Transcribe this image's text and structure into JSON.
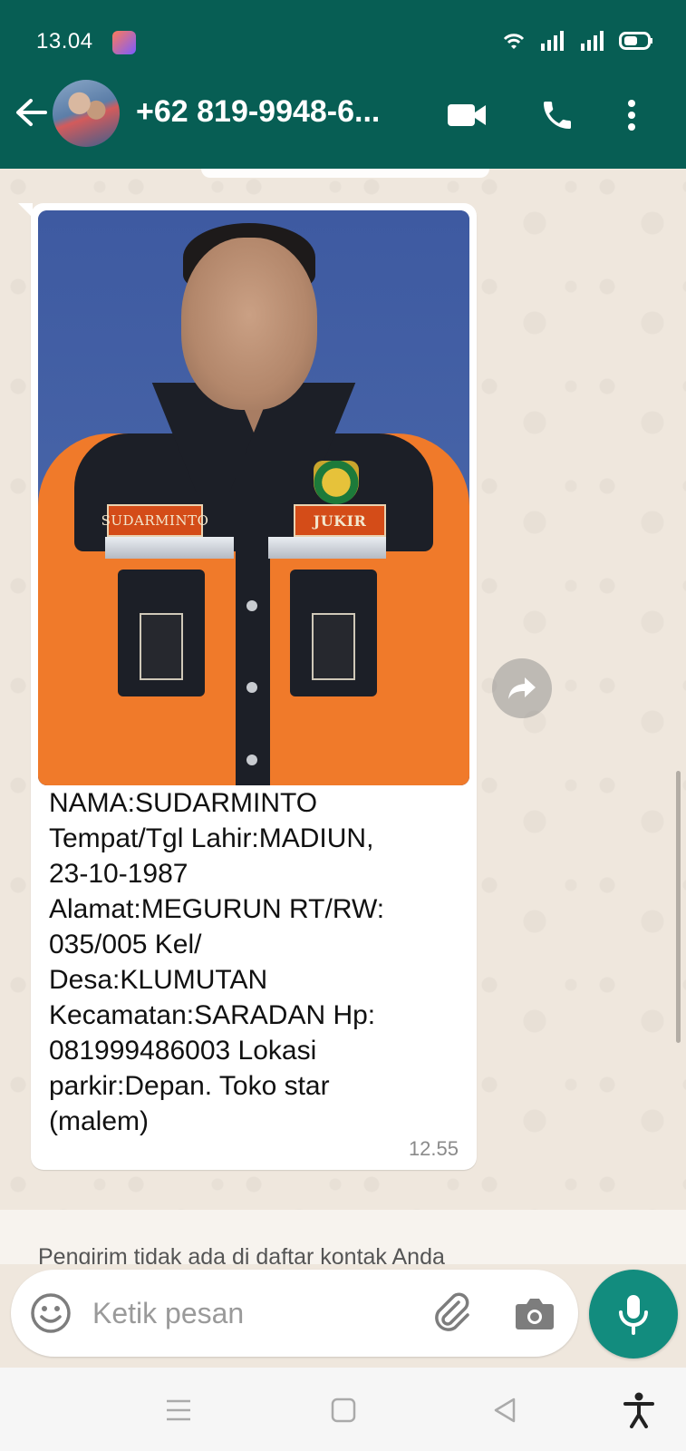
{
  "status_bar": {
    "time": "13.04"
  },
  "header": {
    "contact_name": "+62 819-9948-6..."
  },
  "message": {
    "caption": "NAMA:SUDARMINTO\nTempat/Tgl Lahir:MADIUN,\n23-10-1987\nAlamat:MEGURUN RT/RW:\n035/005 Kel/\nDesa:KLUMUTAN\nKecamatan:SARADAN Hp:\n081999486003 Lokasi\nparkir:Depan. Toko star\n(malem)",
    "time": "12.55",
    "photo_labels": {
      "name_tag": "SUDARMINTO",
      "role_tag": "JUKIR"
    }
  },
  "notice": {
    "text": "Pengirim tidak ada di daftar kontak Anda"
  },
  "composer": {
    "placeholder": "Ketik pesan"
  },
  "colors": {
    "header": "#075e54",
    "accent": "#128c7e",
    "chat_bg": "#efe7dd"
  }
}
